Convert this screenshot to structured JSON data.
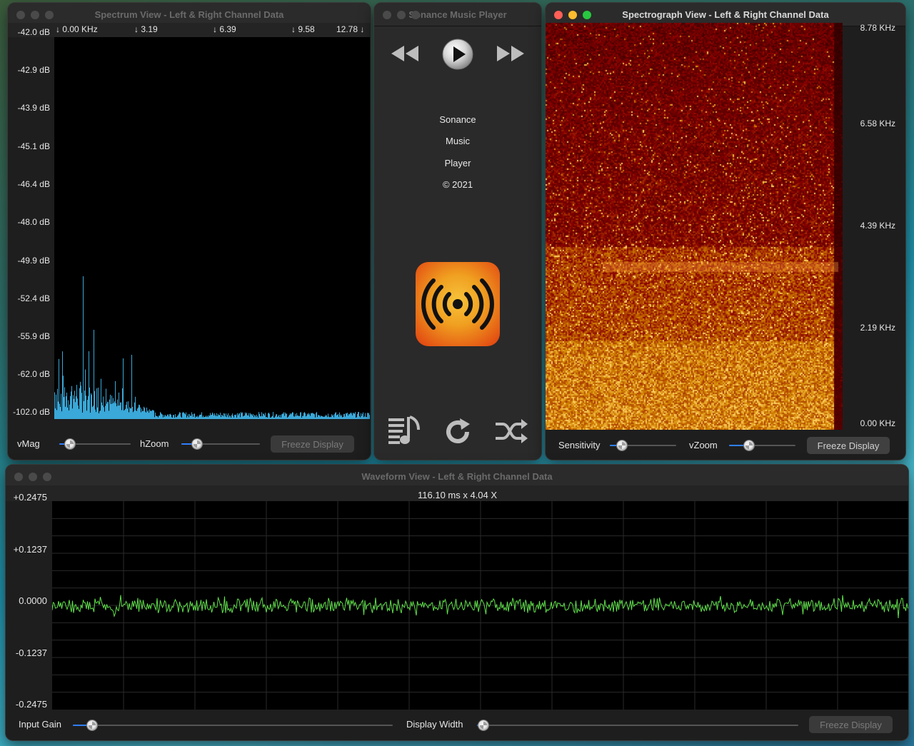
{
  "spectrum_window": {
    "title": "Spectrum View - Left & Right Channel Data",
    "db_labels": [
      "-42.0 dB",
      "-42.9 dB",
      "-43.9 dB",
      "-45.1 dB",
      "-46.4 dB",
      "-48.0 dB",
      "-49.9 dB",
      "-52.4 dB",
      "-55.9 dB",
      "-62.0 dB",
      "-102.0 dB"
    ],
    "freq_markers": [
      "↓ 0.00 KHz",
      "↓ 3.19",
      "↓ 6.39",
      "↓ 9.58",
      "12.78 ↓"
    ],
    "vmag_label": "vMag",
    "hzoom_label": "hZoom",
    "freeze_label": "Freeze Display",
    "vmag_value": 0.15,
    "hzoom_value": 0.2,
    "bar_color": "#3aa8d8"
  },
  "player_window": {
    "title": "Sonance Music Player",
    "info_lines": [
      "Sonance",
      "Music",
      "Player",
      "© 2021"
    ],
    "icons": [
      "rewind-icon",
      "play-icon",
      "fast-forward-icon",
      "playlist-icon",
      "repeat-icon",
      "shuffle-icon"
    ],
    "logo_colors": [
      "#f0a020",
      "#e03c10"
    ]
  },
  "spectrograph_window": {
    "title": "Spectrograph View - Left & Right Channel Data",
    "freq_labels": [
      "8.78 KHz",
      "6.58 KHz",
      "4.39 KHz",
      "2.19 KHz",
      "0.00 KHz"
    ],
    "sensitivity_label": "Sensitivity",
    "vzoom_label": "vZoom",
    "freeze_label": "Freeze Display",
    "sensitivity_value": 0.18,
    "vzoom_value": 0.3
  },
  "waveform_window": {
    "title": "Waveform View - Left & Right Channel Data",
    "scale_readout": "116.10 ms x 4.04 X",
    "amplitude_labels": [
      "+0.2475",
      "+0.1237",
      "0.0000",
      "-0.1237",
      "-0.2475"
    ],
    "input_gain_label": "Input Gain",
    "display_width_label": "Display Width",
    "freeze_label": "Freeze Display",
    "input_gain_value": 0.06,
    "display_width_value": 0.02,
    "wave_color": "#5fe04a"
  }
}
